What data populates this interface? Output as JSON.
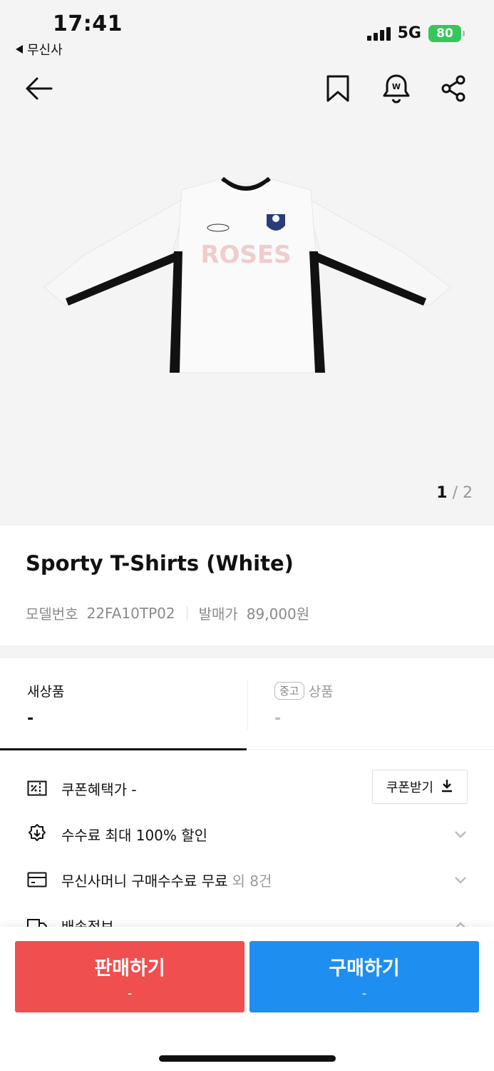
{
  "status_bar": {
    "time": "17:41",
    "back_app": "무신사",
    "network": "5G",
    "battery": "80"
  },
  "nav": {
    "back": "back-icon",
    "bookmark": "bookmark-icon",
    "price_alert": "price-alert-bell-icon",
    "share": "share-icon"
  },
  "hero": {
    "current_page": "1",
    "separator": "/",
    "total_pages": "2",
    "shirt_text": "ROSES"
  },
  "product": {
    "name": "Sporty T-Shirts (White)",
    "model_label": "모델번호",
    "model_value": "22FA10TP02",
    "release_label": "발매가",
    "release_value": "89,000원"
  },
  "tabs": [
    {
      "label": "새상품",
      "value": "-"
    },
    {
      "badge": "중고",
      "label": "상품",
      "value": "-"
    }
  ],
  "benefits": {
    "coupon_label": "쿠폰혜택가 -",
    "coupon_button": "쿠폰받기",
    "fee_label": "수수료 최대 100% 할인",
    "money_label": "무신사머니 구매수수료 무료",
    "money_more": "외 8건",
    "shipping_label": "배송정보"
  },
  "actions": {
    "sell_label": "판매하기",
    "sell_price": "-",
    "buy_label": "구매하기",
    "buy_price": "-"
  },
  "colors": {
    "sell": "#ef4f4f",
    "buy": "#1f8ef1",
    "battery": "#34c759"
  }
}
